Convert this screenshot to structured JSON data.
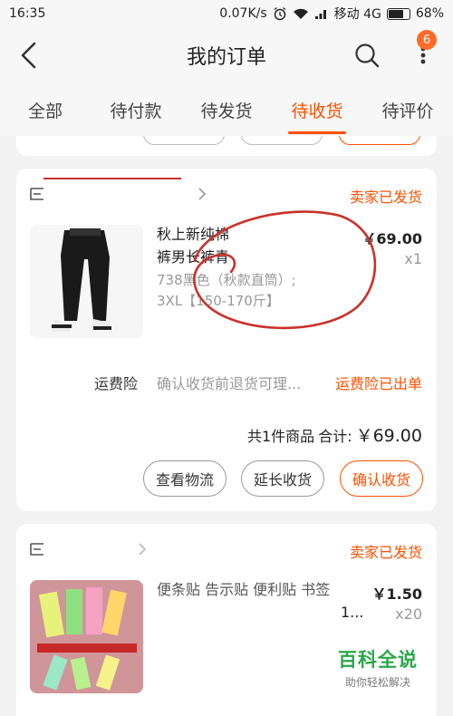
{
  "status_bar": {
    "time": "16:35",
    "speed": "0.07K/s",
    "carrier": "移动 4G",
    "battery": "68%"
  },
  "nav": {
    "title": "我的订单",
    "badge": "6"
  },
  "tabs": [
    {
      "label": "全部"
    },
    {
      "label": "待付款"
    },
    {
      "label": "待发货"
    },
    {
      "label": "待收货",
      "active": true
    },
    {
      "label": "待评价"
    }
  ],
  "orders": [
    {
      "status": "卖家已发货",
      "title_line1": "秋上新纯棉",
      "title_line2": "裤男长裤青",
      "spec_line1": "738黑色（秋款直筒）;",
      "spec_line2": "3XL【150-170斤】",
      "price": "￥69.00",
      "qty": "x1",
      "insurance_label": "运费险",
      "insurance_text": "确认收货前退货可理...",
      "insurance_status": "运费险已出单",
      "total_count": "共1件商品",
      "total_label": "合计:",
      "total_amount": "￥69.00",
      "buttons": [
        "查看物流",
        "延长收货",
        "确认收货"
      ]
    },
    {
      "status": "卖家已发货",
      "title_line1": "便条贴 告示贴 便利贴 书签",
      "title_line2": "1...",
      "price": "￥1.50",
      "qty": "x20"
    }
  ],
  "watermark": {
    "title": "百科全说",
    "subtitle": "助你轻松解决"
  },
  "colors": {
    "accent": "#ff5000",
    "badge": "#ff6a28",
    "watermark": "#2aa84a",
    "annotation": "#c9322a"
  }
}
